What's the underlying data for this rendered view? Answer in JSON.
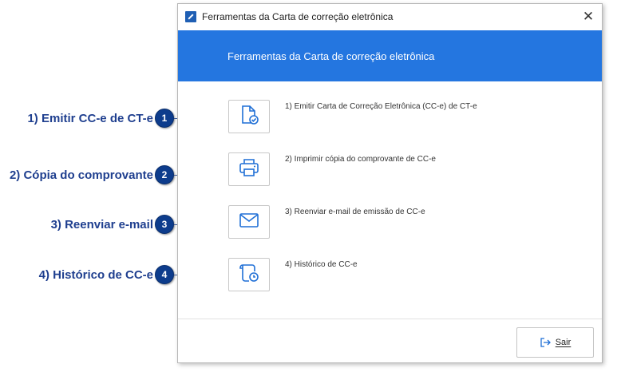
{
  "window": {
    "title": "Ferramentas da Carta de correção eletrônica",
    "close_glyph": "✕",
    "banner": "Ferramentas da Carta de correção eletrônica"
  },
  "tools": [
    {
      "label": "1) Emitir Carta de Correção Eletrônica (CC-e) de CT-e",
      "icon": "document-check-icon"
    },
    {
      "label": "2) Imprimir cópia do comprovante de CC-e",
      "icon": "printer-icon"
    },
    {
      "label": "3) Reenviar e-mail de emissão de CC-e",
      "icon": "envelope-icon"
    },
    {
      "label": "4) Histórico de CC-e",
      "icon": "scroll-clock-icon"
    }
  ],
  "callouts": [
    {
      "text": "1) Emitir CC-e de CT-e",
      "badge": "1"
    },
    {
      "text": "2) Cópia do comprovante",
      "badge": "2"
    },
    {
      "text": "3) Reenviar e-mail",
      "badge": "3"
    },
    {
      "text": "4) Histórico de CC-e",
      "badge": "4"
    }
  ],
  "footer": {
    "exit_label": "Sair"
  },
  "colors": {
    "banner": "#2476e0",
    "icon": "#1f6fd6",
    "callout_text": "#1f3f8f",
    "badge": "#0d3c8c"
  }
}
